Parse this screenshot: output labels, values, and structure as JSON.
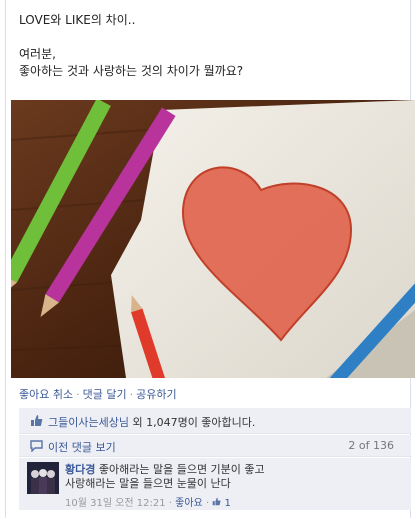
{
  "post": {
    "title": "LOVE와 LIKE의 차이..",
    "line1": "여러분,",
    "line2": "좋아하는 것과 사랑하는 것의 차이가 뭘까요?"
  },
  "actions": {
    "unlike": "좋아요 취소",
    "comment": "댓글 달기",
    "share": "공유하기",
    "separator": "·"
  },
  "likes": {
    "page_name": "그들이사는세상님",
    "rest": " 외 1,047명이 좋아합니다."
  },
  "comments": {
    "prev_label": "이전 댓글 보기",
    "count": "2 of 136",
    "items": [
      {
        "author": "황다경",
        "text1": " 좋아해라는 말을 들으면 기분이 좋고",
        "text2": "사랑해라는 말을 들으면 눈물이 난다",
        "time": "10월 31일 오전 12:21",
        "like_label": "좋아요",
        "like_count": "1"
      }
    ]
  },
  "icons": {
    "like": "thumbs-up-icon",
    "comment": "speech-bubble-icon"
  },
  "colors": {
    "link": "#3b5998",
    "ufi_bg": "#edeff4",
    "heart": "#e0624a"
  }
}
